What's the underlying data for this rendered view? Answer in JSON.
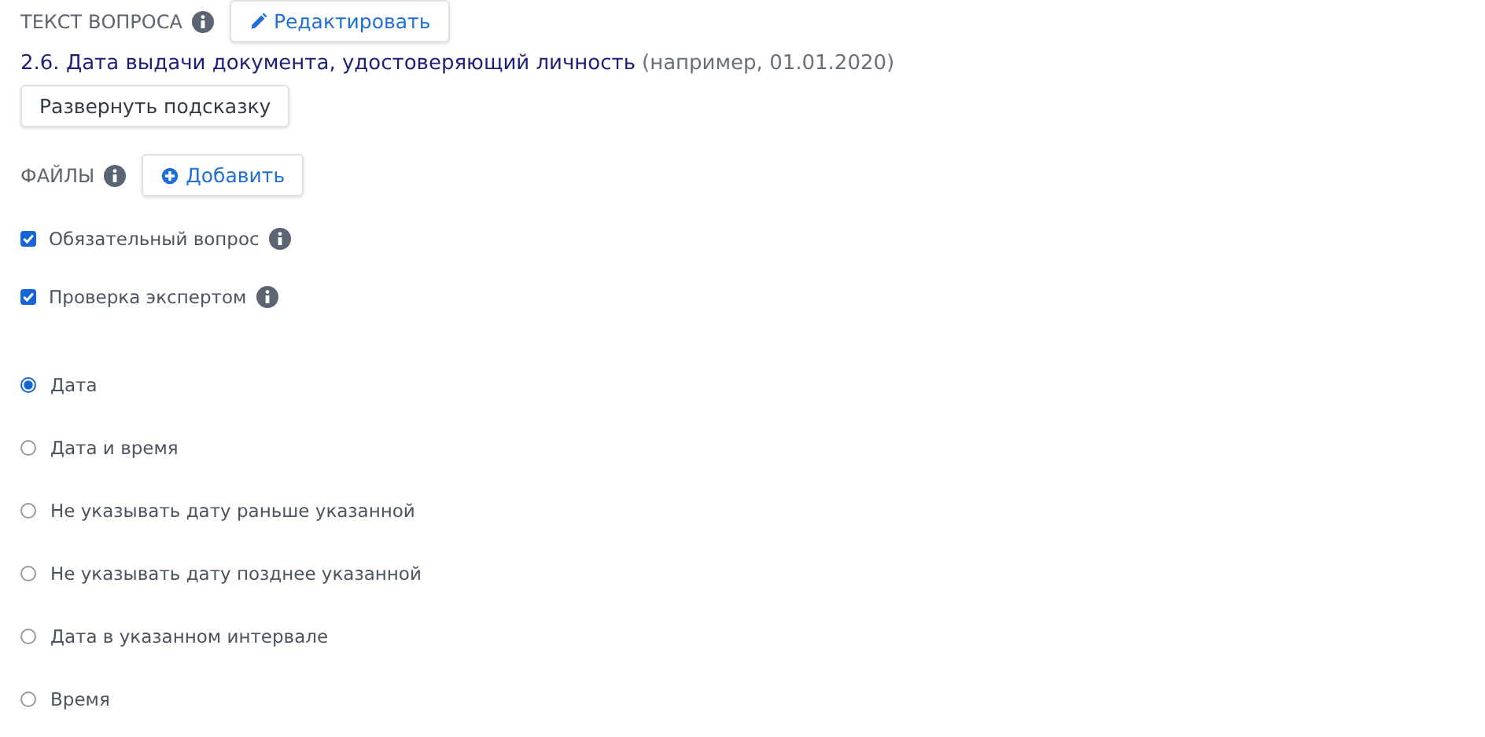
{
  "question_header": {
    "label": "ТЕКСТ ВОПРОСА",
    "button": "Редактировать"
  },
  "question": {
    "text": "2.6. Дата выдачи документа, удостоверяющий личность",
    "hint": "(например, 01.01.2020)"
  },
  "expand_button": "Развернуть подсказку",
  "files": {
    "label": "ФАЙЛЫ",
    "button": "Добавить"
  },
  "options": [
    {
      "label": "Обязательный вопрос",
      "checked": true
    },
    {
      "label": "Проверка экспертом",
      "checked": true
    }
  ],
  "date_types": [
    {
      "label": "Дата",
      "selected": true
    },
    {
      "label": "Дата и время",
      "selected": false
    },
    {
      "label": "Не указывать дату раньше указанной",
      "selected": false
    },
    {
      "label": "Не указывать дату позднее указанной",
      "selected": false
    },
    {
      "label": "Дата в указанном интервале",
      "selected": false
    },
    {
      "label": "Время",
      "selected": false
    }
  ]
}
